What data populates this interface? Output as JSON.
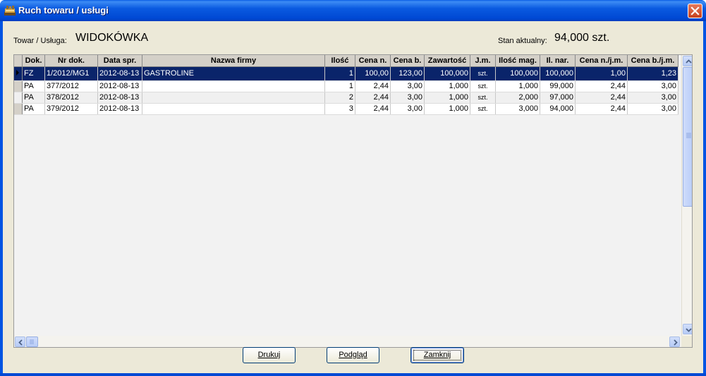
{
  "window": {
    "title": "Ruch towaru / usługi"
  },
  "header": {
    "item_label": "Towar / Usługa:",
    "item_value": "WIDOKÓWKA",
    "stock_label": "Stan aktualny:",
    "stock_value": "94,000 szt."
  },
  "table": {
    "columns": [
      "Dok.",
      "Nr dok.",
      "Data spr.",
      "Nazwa firmy",
      "Ilość",
      "Cena n.",
      "Cena b.",
      "Zawartość",
      "J.m.",
      "Ilość mag.",
      "Il. nar.",
      "Cena n./j.m.",
      "Cena b./j.m."
    ],
    "rows": [
      [
        "FZ",
        "1/2012/MG1",
        "2012-08-13",
        "GASTROLINE",
        "1",
        "100,00",
        "123,00",
        "100,000",
        "szt.",
        "100,000",
        "100,000",
        "1,00",
        "1,23"
      ],
      [
        "PA",
        "377/2012",
        "2012-08-13",
        "",
        "1",
        "2,44",
        "3,00",
        "1,000",
        "szt.",
        "1,000",
        "99,000",
        "2,44",
        "3,00"
      ],
      [
        "PA",
        "378/2012",
        "2012-08-13",
        "",
        "2",
        "2,44",
        "3,00",
        "1,000",
        "szt.",
        "2,000",
        "97,000",
        "2,44",
        "3,00"
      ],
      [
        "PA",
        "379/2012",
        "2012-08-13",
        "",
        "3",
        "2,44",
        "3,00",
        "1,000",
        "szt.",
        "3,000",
        "94,000",
        "2,44",
        "3,00"
      ]
    ],
    "selected_row": 0
  },
  "buttons": {
    "print": "Drukuj",
    "preview": "Podgląd",
    "close": "Zamknij"
  },
  "colors": {
    "title_bar": "#0054e3",
    "selection": "#0a246a",
    "face": "#ece9d8"
  }
}
